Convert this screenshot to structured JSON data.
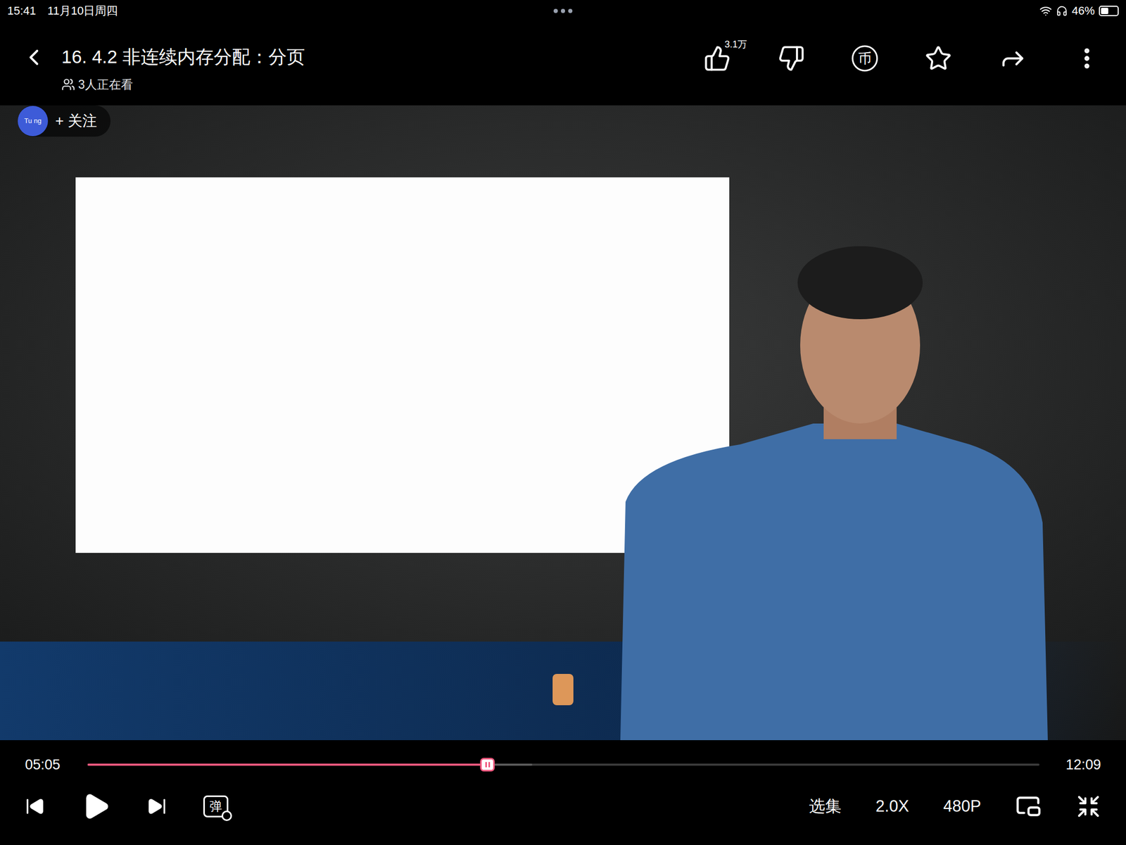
{
  "status_bar": {
    "time": "15:41",
    "date": "11月10日周四",
    "battery": "46%",
    "battery_level": 0.46
  },
  "header": {
    "title": "16. 4.2 非连续内存分配：分页",
    "viewers": "3人正在看",
    "like_count": "3.1万",
    "coin_glyph": "币"
  },
  "uploader": {
    "avatar": "Tu ng",
    "follow": "+ 关注"
  },
  "player": {
    "current": "05:05",
    "duration": "12:09",
    "progress": 0.42,
    "buffered": 0.467,
    "playing": false,
    "danmaku_glyph": "弹",
    "danmaku_on": false,
    "buttons": [
      {
        "label": "选集"
      },
      {
        "label": "2.0X"
      },
      {
        "label": "480P"
      }
    ]
  }
}
